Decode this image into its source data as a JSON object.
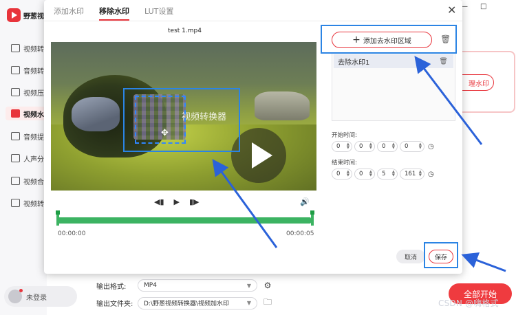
{
  "app": {
    "logo_text": "野葱视",
    "sidebar": [
      {
        "label": "视频转"
      },
      {
        "label": "音频转"
      },
      {
        "label": "视频压"
      },
      {
        "label": "视频水"
      },
      {
        "label": "音频提"
      },
      {
        "label": "人声分"
      },
      {
        "label": "视频合"
      },
      {
        "label": "视频转"
      }
    ],
    "login_label": "未登录",
    "background_button": "理水印",
    "bottom": {
      "format_label": "输出格式:",
      "format_value": "MP4",
      "folder_label": "输出文件夹:",
      "folder_value": "D:\\野葱视频转换器\\视频加水印"
    },
    "start_button": "全部开始",
    "watermark": "CSDN @嗨格式"
  },
  "dialog": {
    "tabs": [
      "添加水印",
      "移除水印",
      "LUT设置"
    ],
    "active_tab": 1,
    "file_title": "test 1.mp4",
    "video_watermark_text": "视频转换器",
    "time_start": "00:00:00",
    "time_end": "00:00:05",
    "add_area_label": "添加去水印区域",
    "list_items": [
      "去除水印1"
    ],
    "start_time_label": "开始时间:",
    "start_time": [
      "0",
      "0",
      "0",
      "0"
    ],
    "end_time_label": "结束时间:",
    "end_time": [
      "0",
      "0",
      "5",
      "161"
    ],
    "cancel_label": "取消",
    "save_label": "保存"
  },
  "colors": {
    "accent_red": "#e8343b",
    "annotation_blue": "#2b84e4",
    "timeline_green": "#3cb362"
  }
}
